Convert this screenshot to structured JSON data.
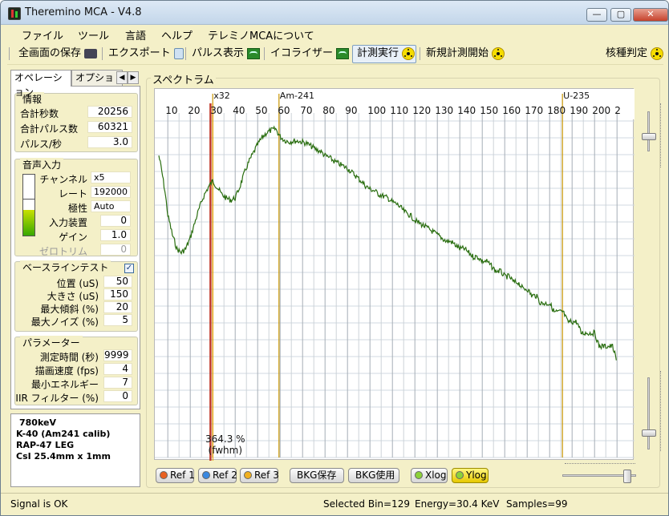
{
  "window": {
    "title": "Theremino MCA - V4.8",
    "btn_min": "—",
    "btn_max": "▢",
    "btn_close": "✕"
  },
  "menu": [
    "ファイル",
    "ツール",
    "言語",
    "ヘルプ",
    "テレミノMCAについて"
  ],
  "toolbar": {
    "save_screen": "全画面の保存",
    "export": "エクスポート",
    "pulse_view": "パルス表示",
    "equalizer": "イコライザー",
    "start": "計測実行",
    "new_start": "新規計測開始",
    "nuclide": "核種判定"
  },
  "tabs": {
    "operation": "オペレーション",
    "options": "オプション",
    "prev": "◀",
    "next": "▶"
  },
  "info": {
    "title": "情報",
    "rows": [
      {
        "label": "合計秒数",
        "value": "20256"
      },
      {
        "label": "合計パルス数",
        "value": "60321"
      },
      {
        "label": "パルス/秒",
        "value": "3.0"
      }
    ]
  },
  "audio": {
    "title": "音声入力",
    "rows": [
      {
        "label": "チャンネル",
        "value": "x5"
      },
      {
        "label": "レート",
        "value": "192000"
      },
      {
        "label": "極性",
        "value": "Auto"
      },
      {
        "label": "入力装置",
        "value": "0"
      },
      {
        "label": "ゲイン",
        "value": "1.0"
      },
      {
        "label": "ゼロトリム",
        "value": "0"
      }
    ],
    "level": 0.42
  },
  "baseline": {
    "title": "ベースラインテスト",
    "checked": "✓",
    "rows": [
      {
        "label": "位置 (uS)",
        "value": "50"
      },
      {
        "label": "大きさ (uS)",
        "value": "150"
      },
      {
        "label": "最大傾斜 (%)",
        "value": "20"
      },
      {
        "label": "最大ノイズ (%)",
        "value": "5"
      }
    ]
  },
  "params": {
    "title": "パラメーター",
    "rows": [
      {
        "label": "測定時間 (秒)",
        "value": "9999"
      },
      {
        "label": "描画速度 (fps)",
        "value": "4"
      },
      {
        "label": "最小エネルギー",
        "value": "7"
      },
      {
        "label": "IIR フィルター (%)",
        "value": "0"
      }
    ]
  },
  "notes": [
    "780keV",
    "K-40 (Am241 calib)",
    "RAP-47 LEG",
    "CsI 25.4mm x 1mm"
  ],
  "spectrum": {
    "title": "スペクトラム",
    "ticks": [
      "10",
      "20",
      "30",
      "40",
      "50",
      "60",
      "70",
      "80",
      "90",
      "100",
      "110",
      "120",
      "130",
      "140",
      "150",
      "160",
      "170",
      "180",
      "190",
      "200",
      "2"
    ],
    "markers": [
      {
        "label": "x32",
        "bin": 30,
        "color": "#c89400"
      },
      {
        "label": "Am-241",
        "bin": 59.5,
        "color": "#c89400"
      },
      {
        "label": "U-235",
        "bin": 185.7,
        "color": "#c89400"
      }
    ],
    "cursor_bin": 29,
    "fwhm_value": "364.3 %",
    "fwhm_label": "(fwhm)",
    "line_color": "#2a6e10"
  },
  "chart_data": {
    "type": "line",
    "title": "",
    "xlabel": "",
    "ylabel": "",
    "xlim": [
      6,
      212
    ],
    "ylim": [
      0,
      100
    ],
    "grid": true,
    "y_scale": "log",
    "x": [
      6,
      8,
      10,
      12,
      14,
      16,
      18,
      20,
      22,
      24,
      26,
      28,
      30,
      32,
      34,
      36,
      38,
      40,
      42,
      44,
      46,
      48,
      50,
      52,
      54,
      56,
      58,
      60,
      62,
      64,
      66,
      68,
      70,
      72,
      74,
      76,
      78,
      80,
      82,
      84,
      86,
      88,
      90,
      92,
      94,
      96,
      98,
      100,
      102,
      104,
      106,
      108,
      110,
      112,
      114,
      116,
      118,
      120,
      122,
      124,
      126,
      128,
      130,
      132,
      134,
      136,
      138,
      140,
      142,
      144,
      146,
      148,
      150,
      152,
      154,
      156,
      158,
      160,
      162,
      164,
      166,
      168,
      170,
      172,
      174,
      176,
      178,
      180,
      182,
      184,
      186,
      188,
      190,
      192,
      194,
      196,
      198,
      200,
      202,
      204,
      206,
      208,
      210
    ],
    "series": [
      {
        "values": [
          68,
          48,
          30,
          23,
          19,
          18,
          19,
          22,
          27,
          33,
          39,
          44,
          48,
          44,
          40,
          38,
          37,
          38,
          44,
          53,
          62,
          70,
          79,
          87,
          93,
          96,
          98,
          88,
          84,
          82,
          83,
          83,
          82,
          80,
          77,
          74,
          72,
          68,
          66,
          63,
          61,
          59,
          57,
          54,
          51,
          48,
          45,
          43,
          42,
          40,
          39,
          38,
          36,
          35,
          33,
          31,
          30,
          28,
          27,
          26,
          25,
          24,
          23,
          22,
          21,
          21,
          20,
          19,
          19,
          18,
          17,
          17,
          16,
          16,
          15,
          14,
          14,
          13,
          13,
          12,
          12,
          11,
          11,
          10,
          10,
          9,
          9,
          9,
          8,
          8,
          8,
          7,
          7,
          7,
          6,
          6,
          6,
          6,
          5,
          5,
          5,
          5,
          4
        ]
      }
    ]
  },
  "buttons": {
    "ref1": "Ref 1",
    "ref2": "Ref 2",
    "ref3": "Ref 3",
    "bkg_save": "BKG保存",
    "bkg_use": "BKG使用",
    "xlog": "Xlog",
    "ylog": "Ylog",
    "ref1_color": "#e86020",
    "ref2_color": "#3a88e0",
    "ref3_color": "#f0b020",
    "log_on_color": "#8cd23a"
  },
  "status": {
    "signal": "Signal is OK",
    "selected_bin": "Selected Bin=129",
    "energy": "Energy=30.4 KeV",
    "samples": "Samples=99"
  }
}
